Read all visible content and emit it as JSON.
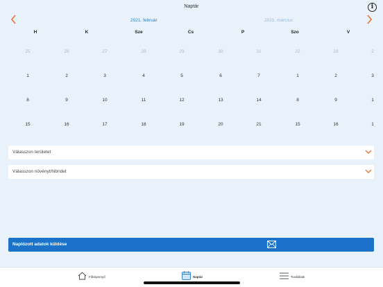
{
  "header": {
    "title": "Naptár",
    "info_icon": "i"
  },
  "nav": {
    "prev_icon": "chevron-left-icon",
    "next_icon": "chevron-right-icon",
    "accent": "#e8763a"
  },
  "calendar": {
    "current_month": "2021. február",
    "next_month": "2021. március",
    "weekdays": [
      "H",
      "K",
      "Sze",
      "Cs",
      "P",
      "Szo",
      "V"
    ],
    "weeks": [
      [
        {
          "day": "25",
          "muted": true
        },
        {
          "day": "26",
          "muted": true
        },
        {
          "day": "27",
          "muted": true
        },
        {
          "day": "28",
          "muted": true
        },
        {
          "day": "29",
          "muted": true
        },
        {
          "day": "30",
          "muted": true
        },
        {
          "day": "31",
          "muted": true
        },
        {
          "day": "22",
          "muted": true
        },
        {
          "day": "23",
          "muted": true
        },
        {
          "day": "2",
          "muted": true
        }
      ],
      [
        {
          "day": "1"
        },
        {
          "day": "2"
        },
        {
          "day": "3"
        },
        {
          "day": "4"
        },
        {
          "day": "5"
        },
        {
          "day": "6"
        },
        {
          "day": "7"
        },
        {
          "day": "1"
        },
        {
          "day": "2"
        },
        {
          "day": "3"
        }
      ],
      [
        {
          "day": "8"
        },
        {
          "day": "9"
        },
        {
          "day": "10"
        },
        {
          "day": "11"
        },
        {
          "day": "12"
        },
        {
          "day": "13"
        },
        {
          "day": "14"
        },
        {
          "day": "8"
        },
        {
          "day": "9"
        },
        {
          "day": "1"
        }
      ],
      [
        {
          "day": "15"
        },
        {
          "day": "16"
        },
        {
          "day": "17"
        },
        {
          "day": "18"
        },
        {
          "day": "19"
        },
        {
          "day": "20"
        },
        {
          "day": "21"
        },
        {
          "day": "15"
        },
        {
          "day": "16"
        },
        {
          "day": "1"
        }
      ]
    ]
  },
  "selects": {
    "area_placeholder": "Válasszon területet",
    "hybrid_placeholder": "Válasszon növényt/hibridet",
    "chevron_icon": "chevron-down-icon"
  },
  "send": {
    "label": "Naplózott adatok küldése",
    "icon": "mail-icon"
  },
  "tabbar": {
    "home": "Főképernyő",
    "calendar": "Naptár",
    "more": "Továbbiak"
  }
}
